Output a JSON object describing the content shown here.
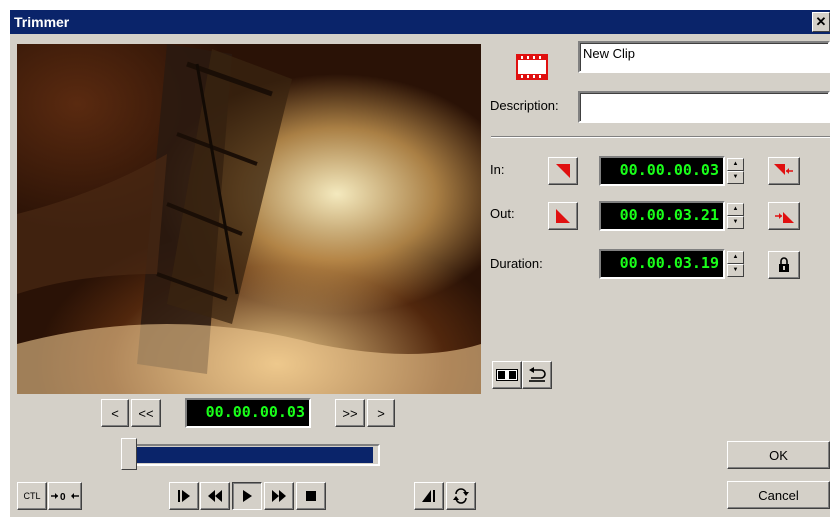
{
  "window": {
    "title": "Trimmer",
    "close_glyph": "✕"
  },
  "clip": {
    "icon": "film-clip-icon",
    "name": "New Clip",
    "description_label": "Description:",
    "description_value": ""
  },
  "timecodes": {
    "in_label": "In:",
    "in_value": "00.00.00.03",
    "out_label": "Out:",
    "out_value": "00.00.03.21",
    "duration_label": "Duration:",
    "duration_value": "00.00.03.19",
    "current_value": "00.00.00.03"
  },
  "nav": {
    "prev_frame": "<",
    "prev_fast": "<<",
    "next_fast": ">>",
    "next_frame": ">"
  },
  "position": {
    "value_fraction": 0.0
  },
  "buttons": {
    "ok": "OK",
    "cancel": "Cancel",
    "ctl": "CTL"
  },
  "colors": {
    "title_bg": "#0a246a",
    "timecode_fg": "#19ff19",
    "mark_red": "#e01010"
  }
}
